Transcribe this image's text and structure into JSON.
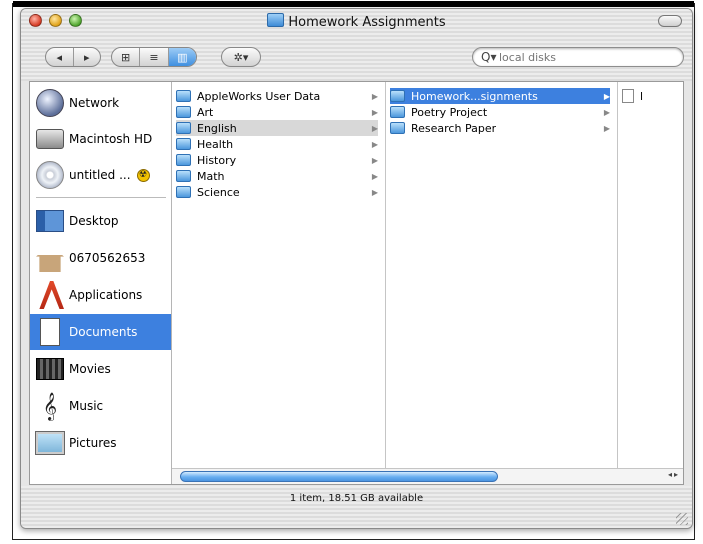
{
  "window": {
    "title": "Homework Assignments"
  },
  "toolbar": {
    "back_glyph": "◂",
    "forward_glyph": "▸",
    "view_icons": "⊞",
    "view_list": "≡",
    "view_columns": "▥",
    "action_glyph": "✲▾",
    "search_glyph": "Q▾",
    "search_placeholder": "local disks"
  },
  "sidebar": {
    "items": [
      {
        "label": "Network",
        "icon": "network-icon"
      },
      {
        "label": "Macintosh HD",
        "icon": "hard-drive-icon"
      },
      {
        "label": "untitled ...",
        "icon": "cd-icon"
      },
      {
        "label": "Desktop",
        "icon": "desktop-icon"
      },
      {
        "label": "0670562653",
        "icon": "home-icon"
      },
      {
        "label": "Applications",
        "icon": "applications-icon"
      },
      {
        "label": "Documents",
        "icon": "documents-icon",
        "selected": true
      },
      {
        "label": "Movies",
        "icon": "movies-icon"
      },
      {
        "label": "Music",
        "icon": "music-icon"
      },
      {
        "label": "Pictures",
        "icon": "pictures-icon"
      }
    ],
    "eject_glyph": "☢"
  },
  "columns": {
    "documents": [
      "AppleWorks User Data",
      "Art",
      "English",
      "Health",
      "History",
      "Math",
      "Science"
    ],
    "documents_highlight": "English",
    "english": [
      "Homework...signments",
      "Poetry Project",
      "Research Paper"
    ],
    "english_selected": "Homework...signments",
    "homework": [
      "l"
    ]
  },
  "status": {
    "text": "1 item, 18.51 GB available"
  },
  "colors": {
    "selection": "#3d80df",
    "window_bg": "#e6e6e6"
  }
}
